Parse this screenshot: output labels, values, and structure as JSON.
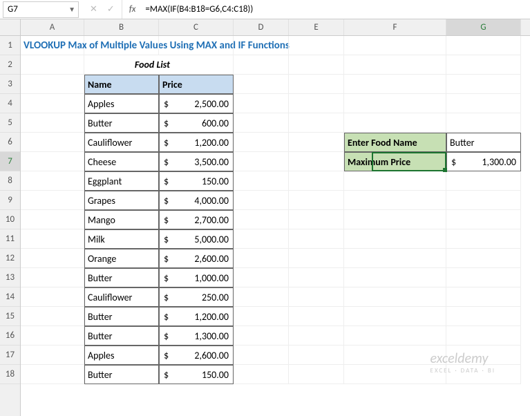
{
  "formula_bar": {
    "name_box": "G7",
    "fx_label": "fx",
    "formula": "=MAX(IF(B4:B18=G6,C4:C18))"
  },
  "columns": [
    "A",
    "B",
    "C",
    "D",
    "E",
    "F",
    "G"
  ],
  "rows": [
    "1",
    "2",
    "3",
    "4",
    "5",
    "6",
    "7",
    "8",
    "9",
    "10",
    "11",
    "12",
    "13",
    "14",
    "15",
    "16",
    "17",
    "18"
  ],
  "selected": {
    "col": "G",
    "row": "7"
  },
  "title": "VLOOKUP Max of Multiple Values Using MAX and IF Functions",
  "subtitle": "Food List",
  "table": {
    "headers": {
      "name": "Name",
      "price": "Price"
    },
    "currency": "$",
    "rows": [
      {
        "name": "Apples",
        "price": "2,500.00"
      },
      {
        "name": "Butter",
        "price": "600.00"
      },
      {
        "name": "Cauliflower",
        "price": "1,200.00"
      },
      {
        "name": "Cheese",
        "price": "3,500.00"
      },
      {
        "name": "Eggplant",
        "price": "150.00"
      },
      {
        "name": "Grapes",
        "price": "4,000.00"
      },
      {
        "name": "Mango",
        "price": "2,700.00"
      },
      {
        "name": "Milk",
        "price": "5,000.00"
      },
      {
        "name": "Orange",
        "price": "2,600.00"
      },
      {
        "name": "Butter",
        "price": "1,000.00"
      },
      {
        "name": "Cauliflower",
        "price": "250.00"
      },
      {
        "name": "Butter",
        "price": "1,200.00"
      },
      {
        "name": "Butter",
        "price": "1,300.00"
      },
      {
        "name": "Apples",
        "price": "2,600.00"
      },
      {
        "name": "Butter",
        "price": "150.00"
      }
    ]
  },
  "lookup": {
    "enter_label": "Enter Food Name",
    "enter_value": "Butter",
    "max_label": "Maximum Price",
    "max_currency": "$",
    "max_value": "1,300.00"
  },
  "watermark": {
    "main": "exceldemy",
    "sub": "EXCEL · DATA · BI"
  }
}
